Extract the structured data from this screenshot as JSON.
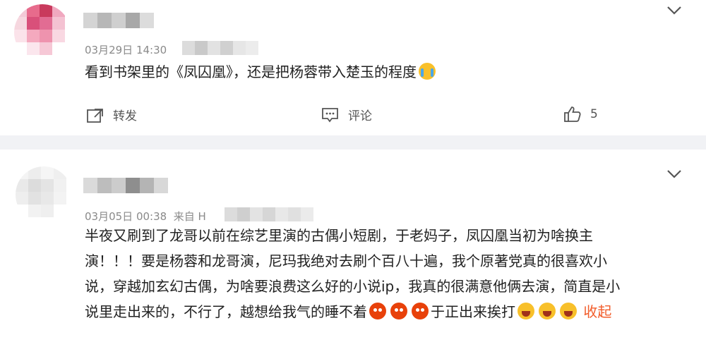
{
  "comments": [
    {
      "time": "03月29日 14:30",
      "source_prefix": "",
      "text": "看到书架里的《凤囚凰》，还是把杨蓉带入楚玉的程度",
      "actions": {
        "repost": "转发",
        "comment": "评论",
        "like_count": "5"
      }
    },
    {
      "time": "03月05日 00:38",
      "source_prefix": "来自 H",
      "lines": [
        "半夜又刷到了龙哥以前在综艺里演的古偶小短剧，于老妈子，凤囚凰当初为啥换主",
        "演！！！要是杨蓉和龙哥演，尼玛我绝对去刷个百八十遍，我个原著党真的很喜欢小",
        "说，穿越加玄幻古偶，为啥要浪费这么好的小说ip，我真的很满意他俩去演，简直是小",
        "说里走出来的，不行了，越想给我气的睡不着"
      ],
      "line4_tail": "于正出来挨打",
      "collapse": "收起"
    }
  ],
  "icons": {
    "chevron": "chevron-down-icon",
    "repost": "repost-icon",
    "comment": "comment-icon",
    "like": "thumbs-up-icon"
  },
  "colors": {
    "accent": "#f25c2a",
    "meta": "#8a8a8a",
    "background": "#f1f2f5"
  }
}
